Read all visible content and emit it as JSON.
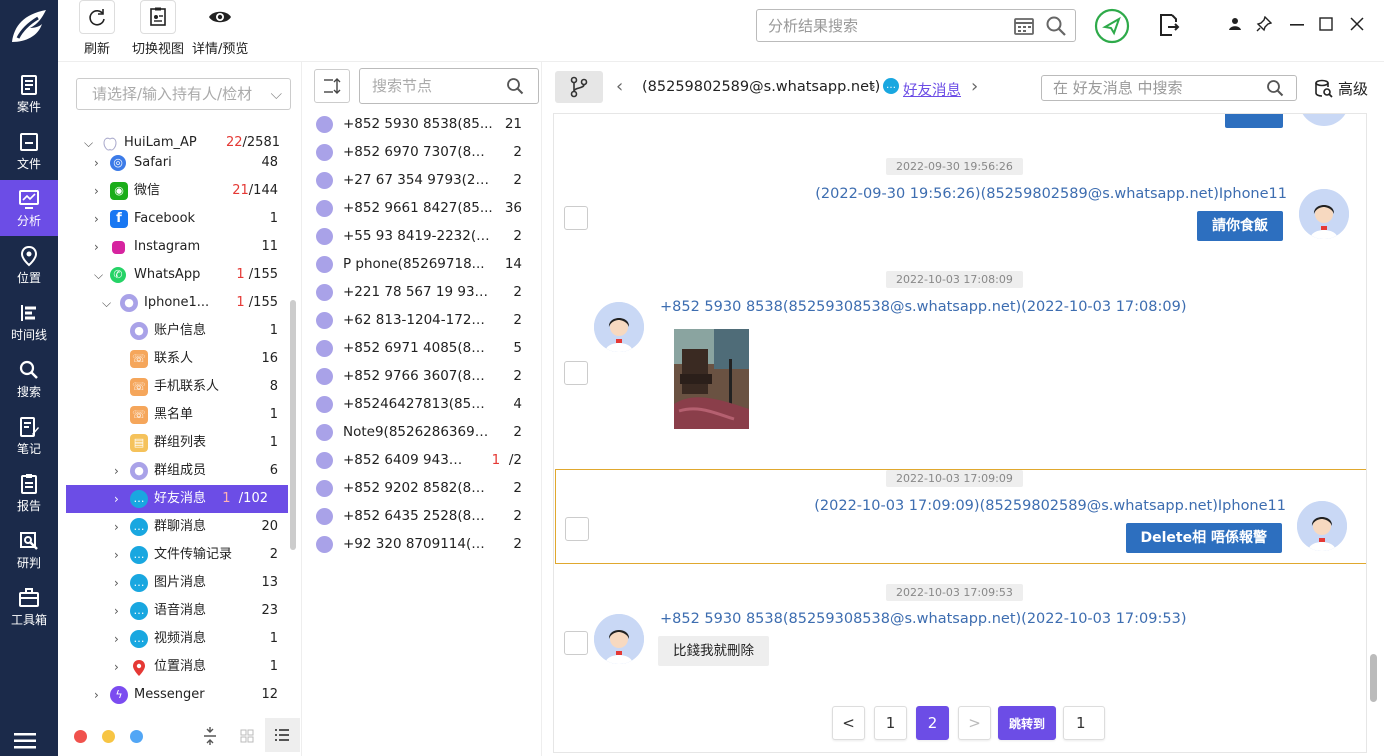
{
  "nav": {
    "items": [
      "案件",
      "文件",
      "分析",
      "位置",
      "时间线",
      "搜索",
      "笔记",
      "报告",
      "研判",
      "工具箱"
    ]
  },
  "toolbar": {
    "refresh_label": "刷新",
    "switch_view_label": "切换视图",
    "detail_label": "详情/预览",
    "search_placeholder": "分析结果搜索"
  },
  "tree": {
    "select_placeholder": "请选择/输入持有人/检材",
    "device": {
      "name": "HuiLam_AP",
      "count_red": "22",
      "count": "/2581"
    },
    "rows": [
      {
        "label": "Safari",
        "count": "48"
      },
      {
        "label": "微信",
        "count_red": "21",
        "count": "/144"
      },
      {
        "label": "Facebook",
        "count": "1"
      },
      {
        "label": "Instagram",
        "count": "11"
      },
      {
        "label": "WhatsApp",
        "count_red": "1",
        "count": "/155"
      },
      {
        "label": "Iphone1...",
        "count_red": "1",
        "count": "/155"
      },
      {
        "label": "账户信息",
        "count": "1"
      },
      {
        "label": "联系人",
        "count": "16"
      },
      {
        "label": "手机联系人",
        "count": "8"
      },
      {
        "label": "黑名单",
        "count": "1"
      },
      {
        "label": "群组列表",
        "count": "1"
      },
      {
        "label": "群组成员",
        "count": "6"
      },
      {
        "label": "好友消息",
        "count_red": "1",
        "count": "/102"
      },
      {
        "label": "群聊消息",
        "count": "20"
      },
      {
        "label": "文件传输记录",
        "count": "2"
      },
      {
        "label": "图片消息",
        "count": "13"
      },
      {
        "label": "语音消息",
        "count": "23"
      },
      {
        "label": "视频消息",
        "count": "1"
      },
      {
        "label": "位置消息",
        "count": "1"
      },
      {
        "label": "Messenger",
        "count": "12"
      }
    ]
  },
  "nodes": {
    "search_placeholder": "搜索节点",
    "rows": [
      {
        "label": "+852 5930 8538(85...",
        "count": "21"
      },
      {
        "label": "+852 6970 7307(852...",
        "count": "2"
      },
      {
        "label": "+27 67 354 9793(27...",
        "count": "2"
      },
      {
        "label": "+852 9661 8427(85...",
        "count": "36"
      },
      {
        "label": "+55 93 8419-2232(5...",
        "count": "2"
      },
      {
        "label": "P phone(85269718...",
        "count": "14"
      },
      {
        "label": "+221 78 567 19 93(2...",
        "count": "2"
      },
      {
        "label": "+62 813-1204-1723(...",
        "count": "2"
      },
      {
        "label": "+852 6971 4085(852...",
        "count": "5"
      },
      {
        "label": "+852 9766 3607(852...",
        "count": "2"
      },
      {
        "label": "+85246427813(8524...",
        "count": "4"
      },
      {
        "label": "Note9(85262863694...",
        "count": "2"
      },
      {
        "label": "+852 6409 9433...",
        "count_red": "1",
        "count": "/2"
      },
      {
        "label": "+852 9202 8582(852...",
        "count": "2"
      },
      {
        "label": "+852 6435 2528(852...",
        "count": "2"
      },
      {
        "label": "+92 320 8709114(92...",
        "count": "2"
      }
    ]
  },
  "chat": {
    "crumb_contact": "(85259802589@s.whatsapp.net)",
    "crumb_current": "好友消息",
    "search_placeholder": "在 好友消息 中搜索",
    "advanced_label": "高级",
    "messages": [
      {
        "time": "2022-09-30 19:56:26",
        "meta": "(2022-09-30 19:56:26)(85259802589@s.whatsapp.net)Iphone11",
        "text": "請你食飯"
      },
      {
        "time": "2022-10-03 17:08:09",
        "meta": "+852 5930 8538(85259308538@s.whatsapp.net)(2022-10-03 17:08:09)"
      },
      {
        "time": "2022-10-03 17:09:09",
        "meta": "(2022-10-03 17:09:09)(85259802589@s.whatsapp.net)Iphone11",
        "text": "Delete相 唔係報警"
      },
      {
        "time": "2022-10-03 17:09:53",
        "meta": "+852 5930 8538(85259308538@s.whatsapp.net)(2022-10-03 17:09:53)",
        "text": "比錢我就刪除"
      }
    ],
    "pager": {
      "prev": "<",
      "page1": "1",
      "page2": "2",
      "next": ">",
      "jump_label": "跳转到",
      "jump_value": "1"
    }
  }
}
